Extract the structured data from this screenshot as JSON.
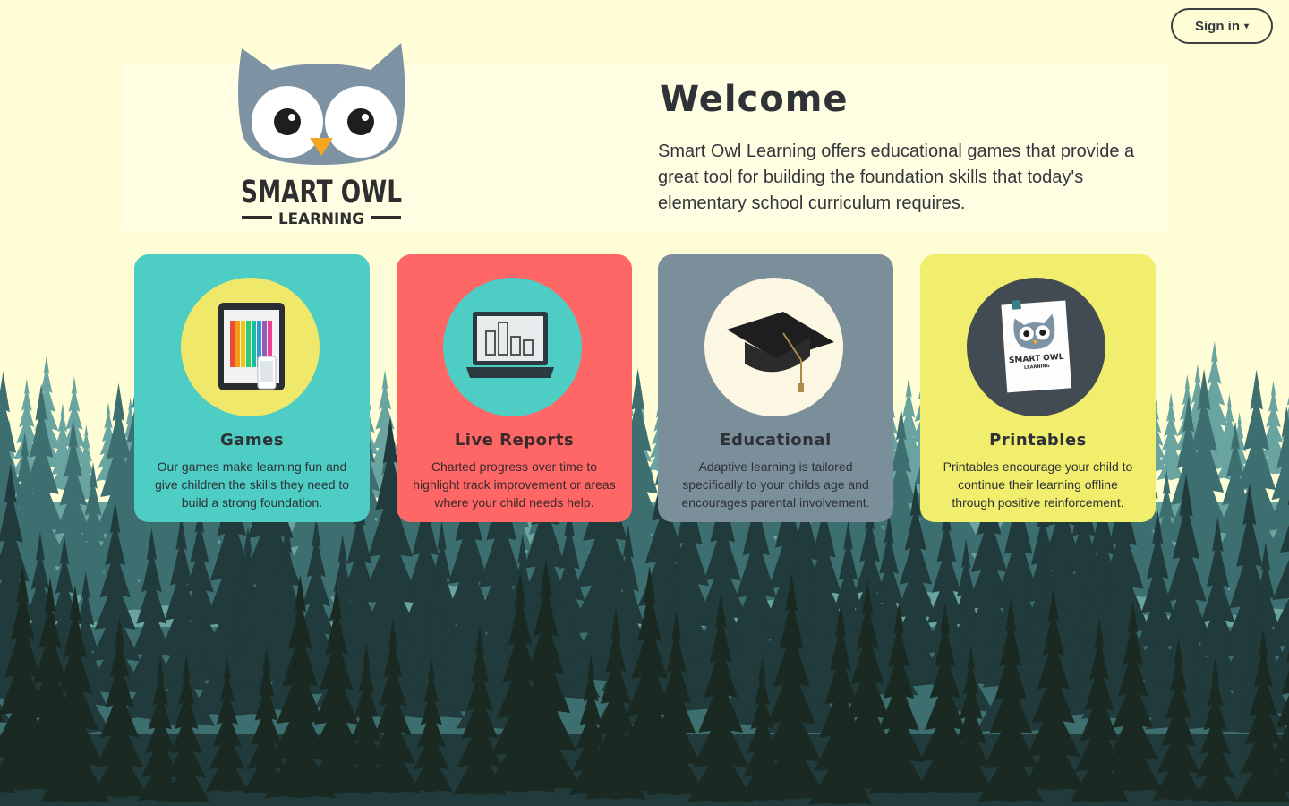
{
  "header": {
    "signin_label": "Sign in",
    "signin_caret": "▾"
  },
  "logo": {
    "line1": "SMART OWL",
    "line2": "LEARNING"
  },
  "hero": {
    "title": "Welcome",
    "description": "Smart Owl Learning offers educational games that provide a great tool for building the foundation skills that today's elementary school curriculum requires."
  },
  "cards": [
    {
      "title": "Games",
      "description": "Our games make learning fun and give children the skills they need to build a strong foundation.",
      "icon": "tablet-pencils-icon"
    },
    {
      "title": "Live Reports",
      "description": "Charted progress over time to highlight track improvement or areas where your child needs help.",
      "icon": "laptop-chart-icon"
    },
    {
      "title": "Educational",
      "description": "Adaptive learning is tailored specifically to your childs age and encourages parental involvement.",
      "icon": "graduation-cap-icon"
    },
    {
      "title": "Printables",
      "description": "Printables encourage your child to continue their learning offline through positive reinforcement.",
      "icon": "printable-sheet-icon"
    }
  ],
  "printable_sheet": {
    "line1": "SMART OWL",
    "line2": "LEARNING"
  },
  "colors": {
    "background": "#fefdd6",
    "games_card": "#4dcdc4",
    "reports_card": "#fe6766",
    "educational_card": "#7b8f9b",
    "printables_card": "#f0ee6c",
    "owl_gray": "#7d93a3",
    "owl_beak": "#f5a623",
    "forest_far": "#5f9b98",
    "forest_mid": "#3a6b6c",
    "forest_near": "#1f3536"
  }
}
